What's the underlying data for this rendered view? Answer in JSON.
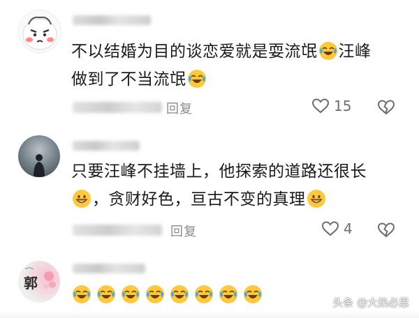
{
  "comments": [
    {
      "text_parts": [
        "不以结婚为目的谈恋爱就是耍流氓",
        "汪峰",
        "做到了不当流氓"
      ],
      "emoji": [
        "laugh-cry-emoji",
        "laugh-cry-emoji"
      ],
      "reply_label": "回复",
      "like_count": "15"
    },
    {
      "text_parts": [
        "只要汪峰不挂墙上，他探索的道路还很长",
        "，贪财好色，亘古不变的真理"
      ],
      "emoji": [
        "grin-emoji",
        "grin-emoji"
      ],
      "reply_label": "回复",
      "like_count": "4"
    },
    {
      "avatar_text": "郭",
      "emoji_row": [
        "laugh-cry-emoji",
        "laugh-cry-emoji",
        "laugh-cry-emoji",
        "laugh-cry-emoji",
        "laugh-cry-emoji",
        "laugh-cry-emoji",
        "laugh-cry-emoji",
        "laugh-cry-emoji"
      ]
    }
  ],
  "watermark": "头条 @大热必思",
  "colors": {
    "text": "#1a1a1a",
    "meta": "#8a8a8a",
    "icon": "#6d6d6d",
    "emoji_face": "#ffc83d",
    "emoji_tear": "#3aa7f0"
  }
}
